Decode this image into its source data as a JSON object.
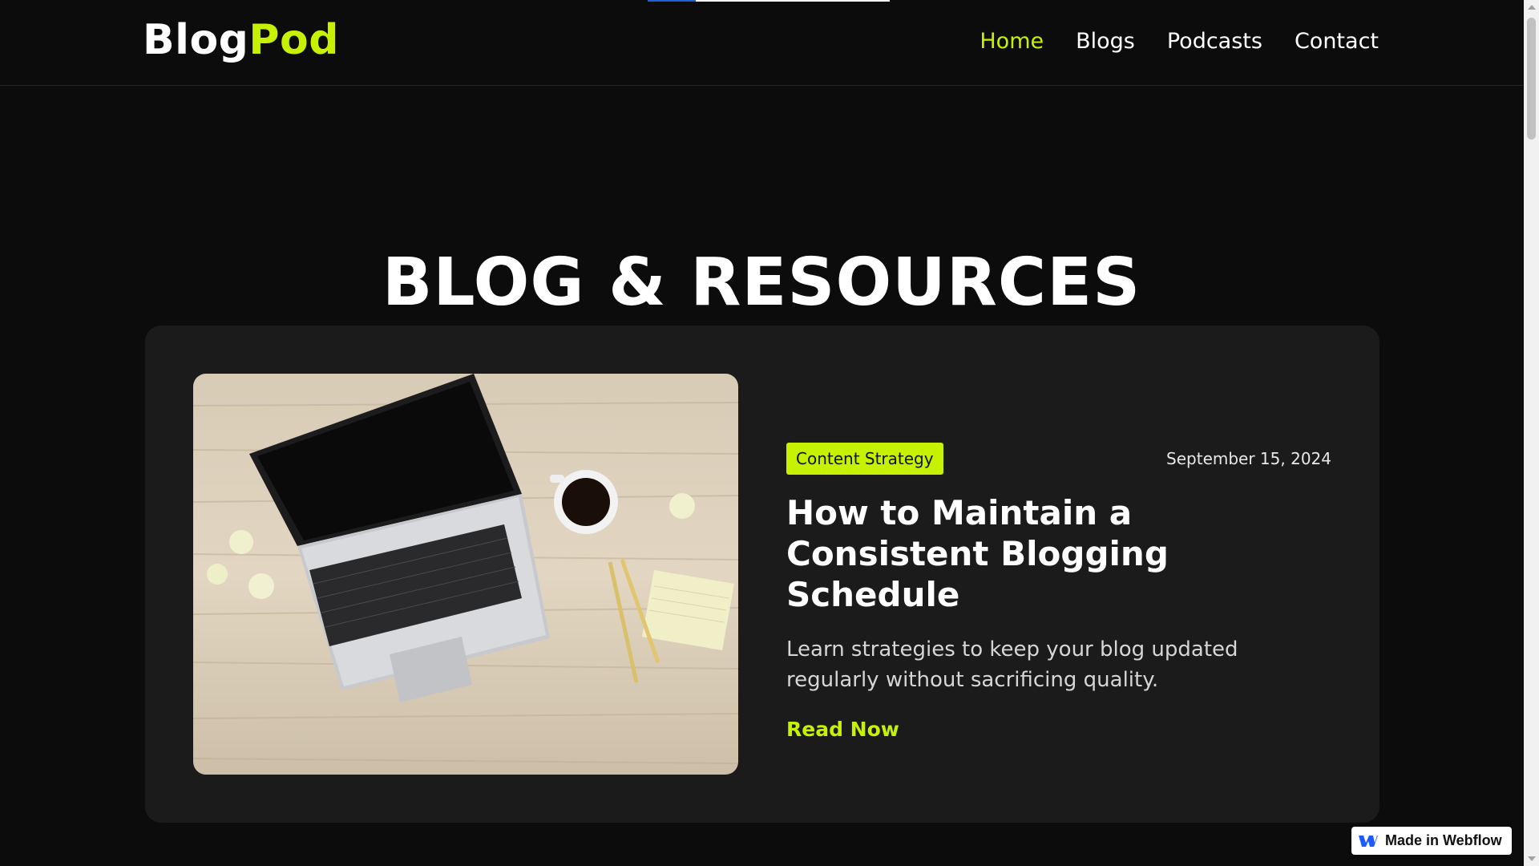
{
  "progress": {
    "fraction": 0.2
  },
  "header": {
    "logo_part1": "Blog",
    "logo_part2": "Pod",
    "nav": [
      {
        "label": "Home",
        "active": true
      },
      {
        "label": "Blogs",
        "active": false
      },
      {
        "label": "Podcasts",
        "active": false
      },
      {
        "label": "Contact",
        "active": false
      }
    ]
  },
  "hero": {
    "title": "BLOG & RESOURCES"
  },
  "featured_post": {
    "category": "Content Strategy",
    "date": "September 15, 2024",
    "title": "How to Maintain a Consistent Blogging Schedule",
    "excerpt": "Learn strategies to keep your blog updated regularly without sacrificing quality.",
    "cta": "Read Now",
    "image_icon": "laptop-desk-photo"
  },
  "webflow_badge": {
    "label": "Made in Webflow",
    "icon": "webflow-logo-icon"
  },
  "colors": {
    "background": "#0c0c0c",
    "card": "#1b1b1b",
    "accent": "#c6f100",
    "text": "#ffffff"
  }
}
